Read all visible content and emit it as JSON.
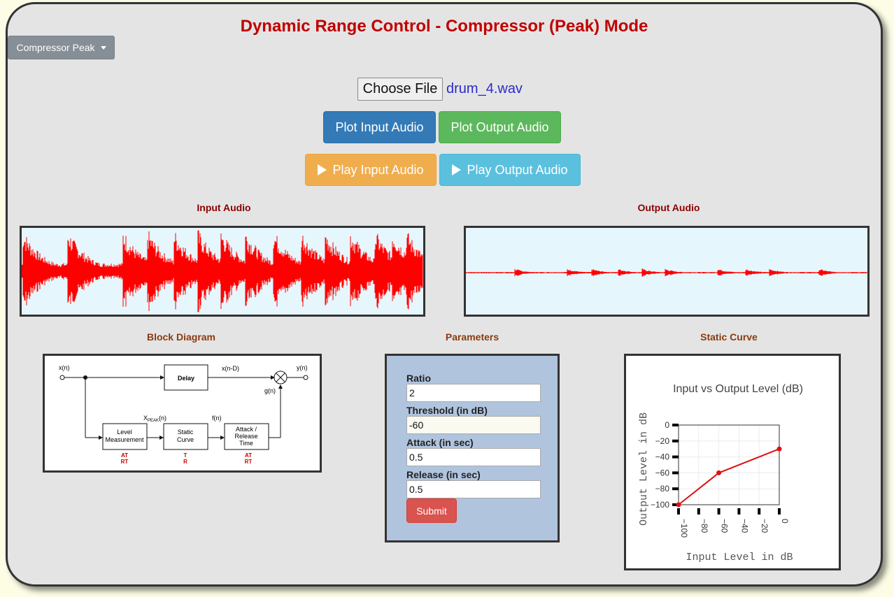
{
  "page": {
    "title": "Dynamic Range Control - Compressor (Peak) Mode"
  },
  "mode_dropdown": {
    "label": "Compressor Peak"
  },
  "file": {
    "button_label": "Choose File",
    "file_name": "drum_4.wav"
  },
  "buttons": {
    "plot_input": "Plot Input Audio",
    "plot_output": "Plot Output Audio",
    "play_input": "Play Input Audio",
    "play_output": "Play Output Audio"
  },
  "sections": {
    "input_audio": "Input Audio",
    "output_audio": "Output Audio",
    "block_diagram": "Block Diagram",
    "parameters": "Parameters",
    "static_curve": "Static Curve"
  },
  "block_diagram": {
    "x_in": "x(n)",
    "delay": "Delay",
    "x_delayed": "x(n-D)",
    "y_out": "y(n)",
    "gain": "g(n)",
    "xpeak_main": "X",
    "xpeak_sub": "PEAK",
    "xpeak_arg": "(n)",
    "f": "f(n)",
    "level_line1": "Level",
    "level_line2": "Measurement",
    "static_line1": "Static",
    "static_line2": "Curve",
    "attack_line1": "Attack /",
    "attack_line2": "Release",
    "attack_line3": "Time",
    "level_p1": "AT",
    "level_p2": "RT",
    "static_p1": "T",
    "static_p2": "R",
    "attack_p1": "AT",
    "attack_p2": "RT"
  },
  "parameters": {
    "ratio_label": "Ratio",
    "ratio_value": "2",
    "threshold_label": "Threshold (in dB)",
    "threshold_value": "-60",
    "attack_label": "Attack (in sec)",
    "attack_value": "0.5",
    "release_label": "Release (in sec)",
    "release_value": "0.5",
    "submit_label": "Submit"
  },
  "colors": {
    "title": "#c00000",
    "waveform": "#ff0000",
    "diagram_params": "#cc0000",
    "curve": "#dd1111"
  },
  "chart_data": {
    "type": "line",
    "title": "Input vs Output Level (dB)",
    "xlabel": "Input Level in dB",
    "ylabel": "Output Level in dB",
    "x": [
      -100,
      -60,
      0
    ],
    "y": [
      -100,
      -60,
      -30
    ],
    "xticks": [
      "−100",
      "−80",
      "−60",
      "−40",
      "−20",
      "0"
    ],
    "yticks": [
      "0",
      "−20",
      "−40",
      "−60",
      "−80",
      "−100"
    ],
    "xlim": [
      -100,
      0
    ],
    "ylim": [
      -100,
      0
    ],
    "grid": true
  }
}
